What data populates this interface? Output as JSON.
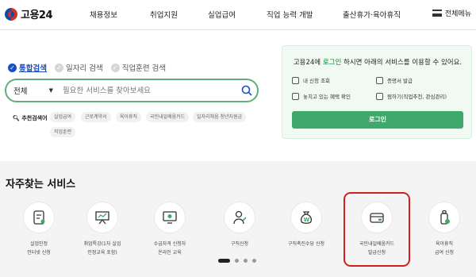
{
  "header": {
    "logo_text": "고용24",
    "nav": [
      "채용정보",
      "취업지원",
      "실업급여",
      "직업 능력 개발",
      "출산휴가·육아휴직"
    ],
    "menu_label": "전체메뉴"
  },
  "search": {
    "tabs": [
      "통합검색",
      "일자리 검색",
      "직업훈련 검색"
    ],
    "active_tab": 0,
    "scope": "전체",
    "placeholder": "필요한 서비스를 찾아보세요",
    "keywords_label": "추천검색어",
    "keywords": [
      "실업급여",
      "근로계약서",
      "육아휴직",
      "국민내일배움카드",
      "일자리채움 청년지원금",
      "직업훈련"
    ]
  },
  "login_panel": {
    "msg_prefix": "고용24에 ",
    "msg_link": "로그인",
    "msg_suffix": " 하시면 아래의 서비스를 이용할 수 있어요.",
    "items": [
      "내 신청 조회",
      "증명서 발급",
      "놓치고 있는 혜택 확인",
      "찜하기(직업추천, 관심관리)"
    ],
    "login_button": "로그인"
  },
  "frequent": {
    "title": "자주찾는 서비스",
    "services": [
      {
        "label": "실업인정\n인터넷 신청",
        "icon": "document-icon"
      },
      {
        "label": "취업특강(1차 실업\n인정교육 포함)",
        "icon": "presentation-icon"
      },
      {
        "label": "수급자격 신청자\n온라인 교육",
        "icon": "monitor-icon"
      },
      {
        "label": "구직신청",
        "icon": "person-icon"
      },
      {
        "label": "구직촉진수당 신청",
        "icon": "money-bag-icon"
      },
      {
        "label": "국민내일배움카드\n발급신청",
        "icon": "card-icon"
      },
      {
        "label": "육아휴직\n급여 신청",
        "icon": "baby-bottle-icon"
      }
    ],
    "page_dots": 4,
    "active_dot": 0
  },
  "colors": {
    "brand_green": "#3fa96b",
    "link_blue": "#1a4fc4",
    "highlight_red": "#d0201c"
  }
}
